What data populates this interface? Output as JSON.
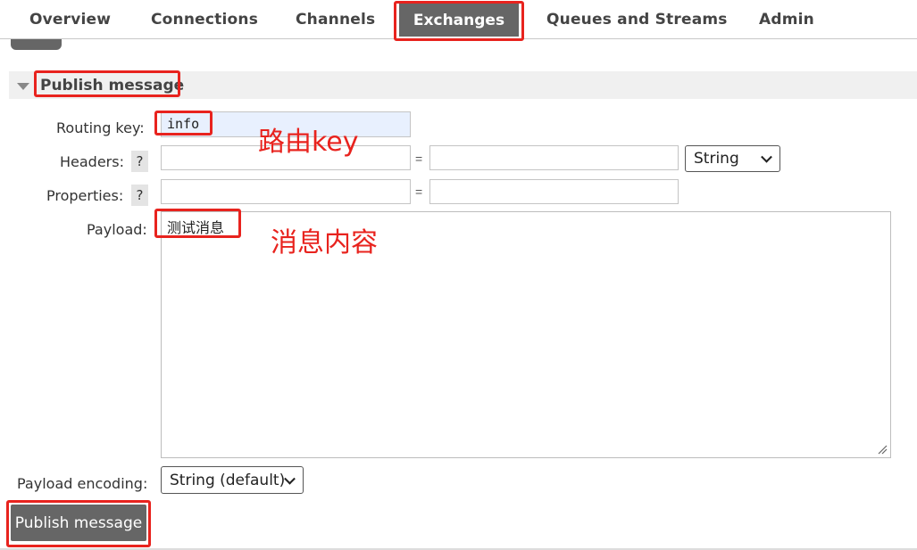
{
  "nav": {
    "tabs": [
      "Overview",
      "Connections",
      "Channels",
      "Exchanges",
      "Queues and Streams",
      "Admin"
    ],
    "active_tab": "Exchanges"
  },
  "section": {
    "title": "Publish message"
  },
  "form": {
    "routing_key_label": "Routing key:",
    "routing_key_value": "info",
    "headers_label": "Headers:",
    "properties_label": "Properties:",
    "help_glyph": "?",
    "equals": "=",
    "headers_type": "String",
    "payload_label": "Payload:",
    "payload_value": "测试消息",
    "payload_encoding_label": "Payload encoding:",
    "payload_encoding_value": "String (default)",
    "publish_button": "Publish message"
  },
  "annotations": {
    "routing_key_note": "路由key",
    "payload_note": "消息内容",
    "color": "#e8231e"
  },
  "colors": {
    "tab_active_bg": "#666666",
    "button_bg": "#666666",
    "section_bg": "#f0f0f0"
  }
}
